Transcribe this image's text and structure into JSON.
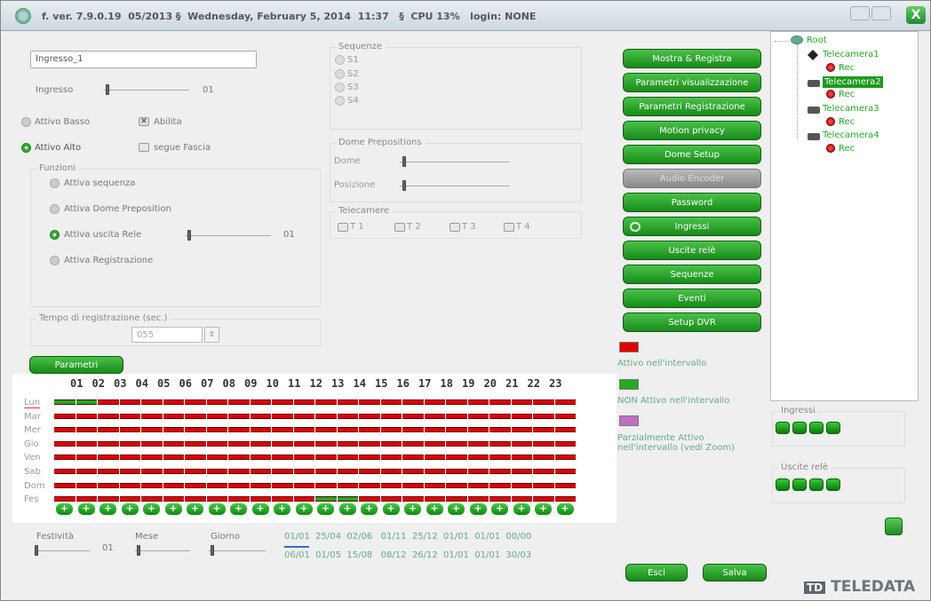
{
  "titlebar": {
    "text": "f. ver. 7.9.0.19  05/2013 §  Wednesday, February 5, 2014  11:37   §  CPU 13%   login: NONE",
    "close": "X"
  },
  "ingresso_name": "Ingresso_1",
  "ingresso": {
    "label": "Ingresso",
    "value": "01"
  },
  "opts": {
    "attivo_basso": "Attivo Basso",
    "abilita": "Abilita",
    "attivo_alto": "Attivo Alto",
    "segue_fascia": "segue Fascia"
  },
  "funzioni": {
    "title": "Funzioni",
    "seq": "Attiva sequenza",
    "dome": "Attiva Dome Preposition",
    "rele": "Attiva uscita Rele",
    "rele_value": "01",
    "reg": "Attiva Registrazione"
  },
  "tempo": {
    "title": "Tempo di registrazione (sec.)",
    "value": "055"
  },
  "sequenze": {
    "title": "Sequenze",
    "items": [
      "S1",
      "S2",
      "S3",
      "S4"
    ]
  },
  "dome": {
    "title": "Dome Prepositions",
    "dome": "Dome",
    "posizione": "Posizione"
  },
  "telecamere": {
    "title": "Telecamere",
    "items": [
      "T 1",
      "T 2",
      "T 3",
      "T 4"
    ]
  },
  "menu": [
    "Mostra & Registra",
    "Parametri visualizzazione",
    "Parametri Registrazione",
    "Motion privacy",
    "Dome Setup",
    "Audio Encoder",
    "Password",
    "Ingressi",
    "Uscite relè",
    "Sequenze",
    "Eventi",
    "Setup DVR"
  ],
  "parametri_btn": "Parametri",
  "legend": {
    "red": "Attivo nell'intervallo",
    "green": "NON Attivo nell'intervallo",
    "purple": "Parzialmente Attivo nell'intervallo (vedi Zoom)",
    "red_color": "#e00000",
    "green_color": "#22aa22",
    "purple_color": "#c070c0"
  },
  "tree": {
    "root": "Root",
    "cams": [
      "Telecamera1",
      "Telecamera2",
      "Telecamera3",
      "Telecamera4"
    ],
    "rec": "Rec"
  },
  "ingressi_label": "Ingressi",
  "uscite_label": "Uscite relè",
  "hours": [
    "01",
    "02",
    "03",
    "04",
    "05",
    "06",
    "07",
    "08",
    "09",
    "10",
    "11",
    "12",
    "13",
    "14",
    "15",
    "16",
    "17",
    "18",
    "19",
    "20",
    "21",
    "22",
    "23"
  ],
  "days": [
    "Lun",
    "Mar",
    "Mer",
    "Gio",
    "Ven",
    "Sab",
    "Dom",
    "Fes"
  ],
  "festivita": {
    "label": "Festività",
    "value": "01",
    "mese": "Mese",
    "giorno": "Giorno"
  },
  "dates_row1": "01/01  25/04  02/06   01/11  25/12  01/01  01/01  00/00",
  "dates_row2": "06/01  01/05  15/08   08/12  26/12  01/01  01/01  30/03",
  "esci": "Esci",
  "salva": "Salva",
  "logo": "TELEDATA"
}
